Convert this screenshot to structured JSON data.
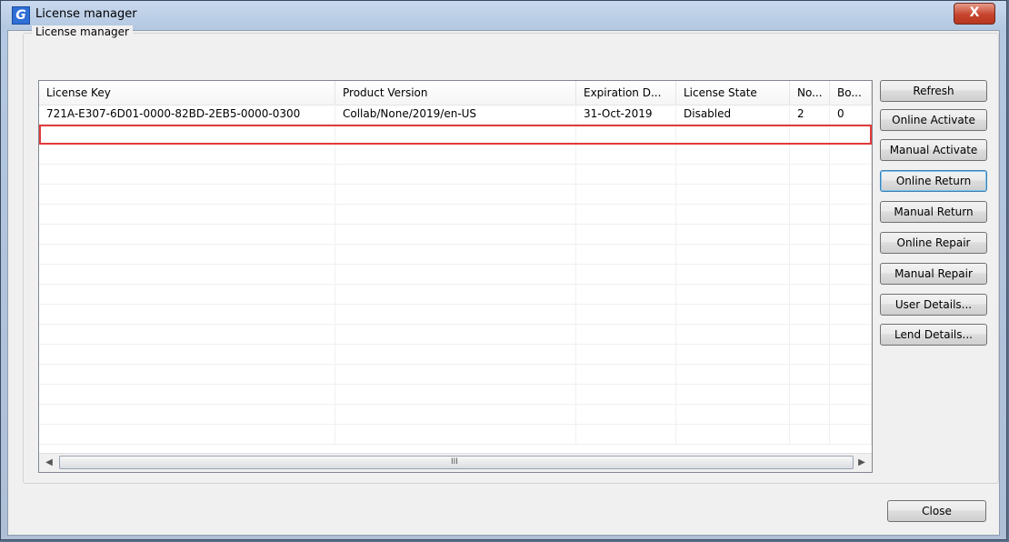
{
  "window": {
    "title": "License manager",
    "close_glyph": "X"
  },
  "group": {
    "label": "License manager"
  },
  "table": {
    "columns": [
      "License Key",
      "Product Version",
      "Expiration D...",
      "License State",
      "No...",
      "Bo..."
    ],
    "rows": [
      {
        "license_key": "721A-E307-6D01-0000-82BD-2EB5-0000-0300",
        "product_version": "Collab/None/2019/en-US",
        "expiration": "31-Oct-2019",
        "state": "Disabled",
        "no": "2",
        "bo": "0"
      }
    ],
    "scroll_grip": "III"
  },
  "buttons": {
    "refresh": "Refresh",
    "online_activate": "Online Activate",
    "manual_activate": "Manual Activate",
    "online_return": "Online Return",
    "manual_return": "Manual Return",
    "online_repair": "Online Repair",
    "manual_repair": "Manual Repair",
    "user_details": "User Details...",
    "lend_details": "Lend Details...",
    "close": "Close"
  },
  "icons": {
    "app": "app-logo-icon",
    "scroll_left": "arrow-left-icon",
    "scroll_right": "arrow-right-icon"
  },
  "colors": {
    "highlight": "#e23b3b",
    "title_close": "#c7442d"
  }
}
